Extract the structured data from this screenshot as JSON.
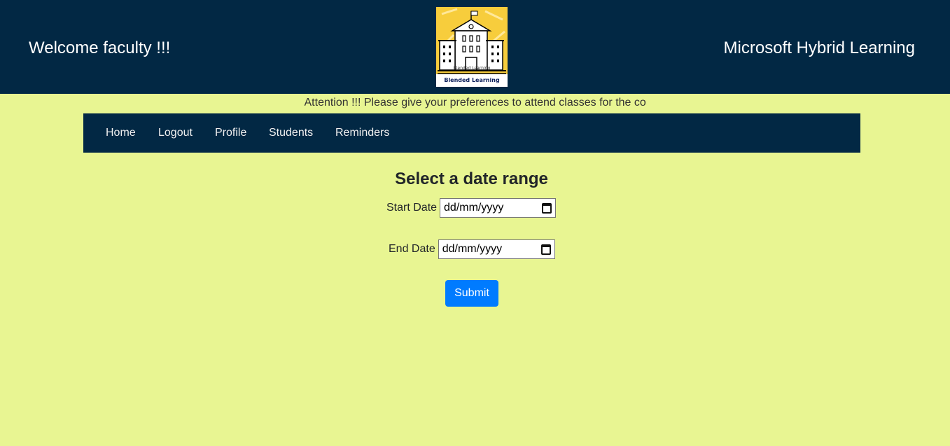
{
  "header": {
    "welcome": "Welcome faculty !!!",
    "brand": "Microsoft Hybrid Learning",
    "logo": {
      "caption_small": "Blended Learning",
      "caption_main": "Blended Learning",
      "icon": "school-building-icon"
    }
  },
  "announcement": "Attention !!! Please give your preferences to attend classes for the co",
  "nav": {
    "items": [
      "Home",
      "Logout",
      "Profile",
      "Students",
      "Reminders"
    ]
  },
  "form": {
    "title": "Select a date range",
    "start_label": "Start Date",
    "start_value": "dd/mm/yyyy",
    "end_label": "End Date",
    "end_value": "dd/mm/yyyy",
    "submit_label": "Submit"
  },
  "colors": {
    "header_bg": "#022844",
    "page_bg": "#e8f592",
    "button_bg": "#007bff"
  }
}
